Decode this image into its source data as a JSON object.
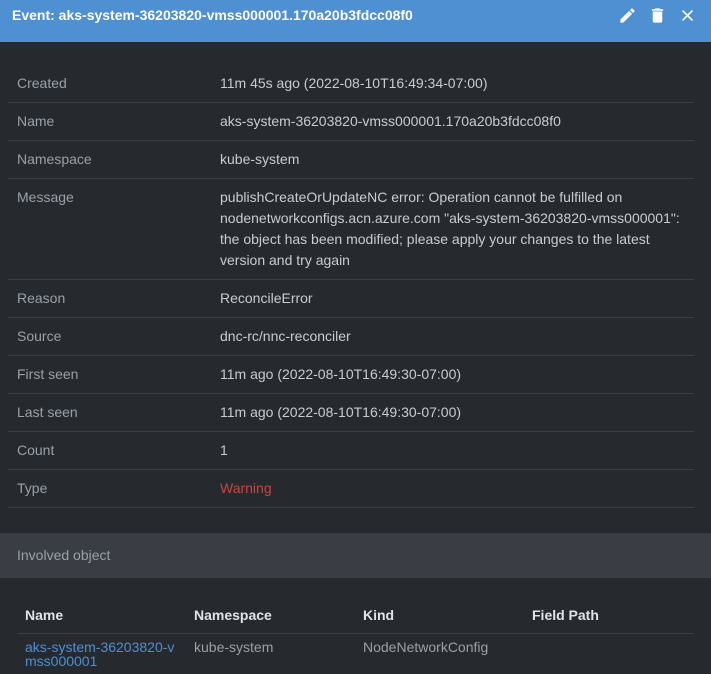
{
  "header": {
    "title": "Event: aks-system-36203820-vmss000001.170a20b3fdcc08f0",
    "actions": {
      "edit_icon": "pencil-icon",
      "delete_icon": "trash-icon",
      "close_icon": "close-icon"
    }
  },
  "details": [
    {
      "label": "Created",
      "value": "11m 45s ago (2022-08-10T16:49:34-07:00)"
    },
    {
      "label": "Name",
      "value": "aks-system-36203820-vmss000001.170a20b3fdcc08f0"
    },
    {
      "label": "Namespace",
      "value": "kube-system"
    },
    {
      "label": "Message",
      "value": "publishCreateOrUpdateNC error: Operation cannot be fulfilled on nodenetworkconfigs.acn.azure.com \"aks-system-36203820-vmss000001\": the object has been modified; please apply your changes to the latest version and try again"
    },
    {
      "label": "Reason",
      "value": "ReconcileError"
    },
    {
      "label": "Source",
      "value": "dnc-rc/nnc-reconciler"
    },
    {
      "label": "First seen",
      "value": "11m ago (2022-08-10T16:49:30-07:00)"
    },
    {
      "label": "Last seen",
      "value": "11m ago (2022-08-10T16:49:30-07:00)"
    },
    {
      "label": "Count",
      "value": "1"
    },
    {
      "label": "Type",
      "value": "Warning"
    }
  ],
  "involved_object": {
    "section_title": "Involved object",
    "columns": [
      "Name",
      "Namespace",
      "Kind",
      "Field Path"
    ],
    "rows": [
      {
        "name": "aks-system-36203820-vmss000001",
        "namespace": "kube-system",
        "kind": "NodeNetworkConfig",
        "field_path": ""
      }
    ]
  },
  "colors": {
    "header_bg": "#4f90d3",
    "panel_bg": "#262a2f",
    "warning": "#c8473d",
    "link": "#4f8fce"
  }
}
